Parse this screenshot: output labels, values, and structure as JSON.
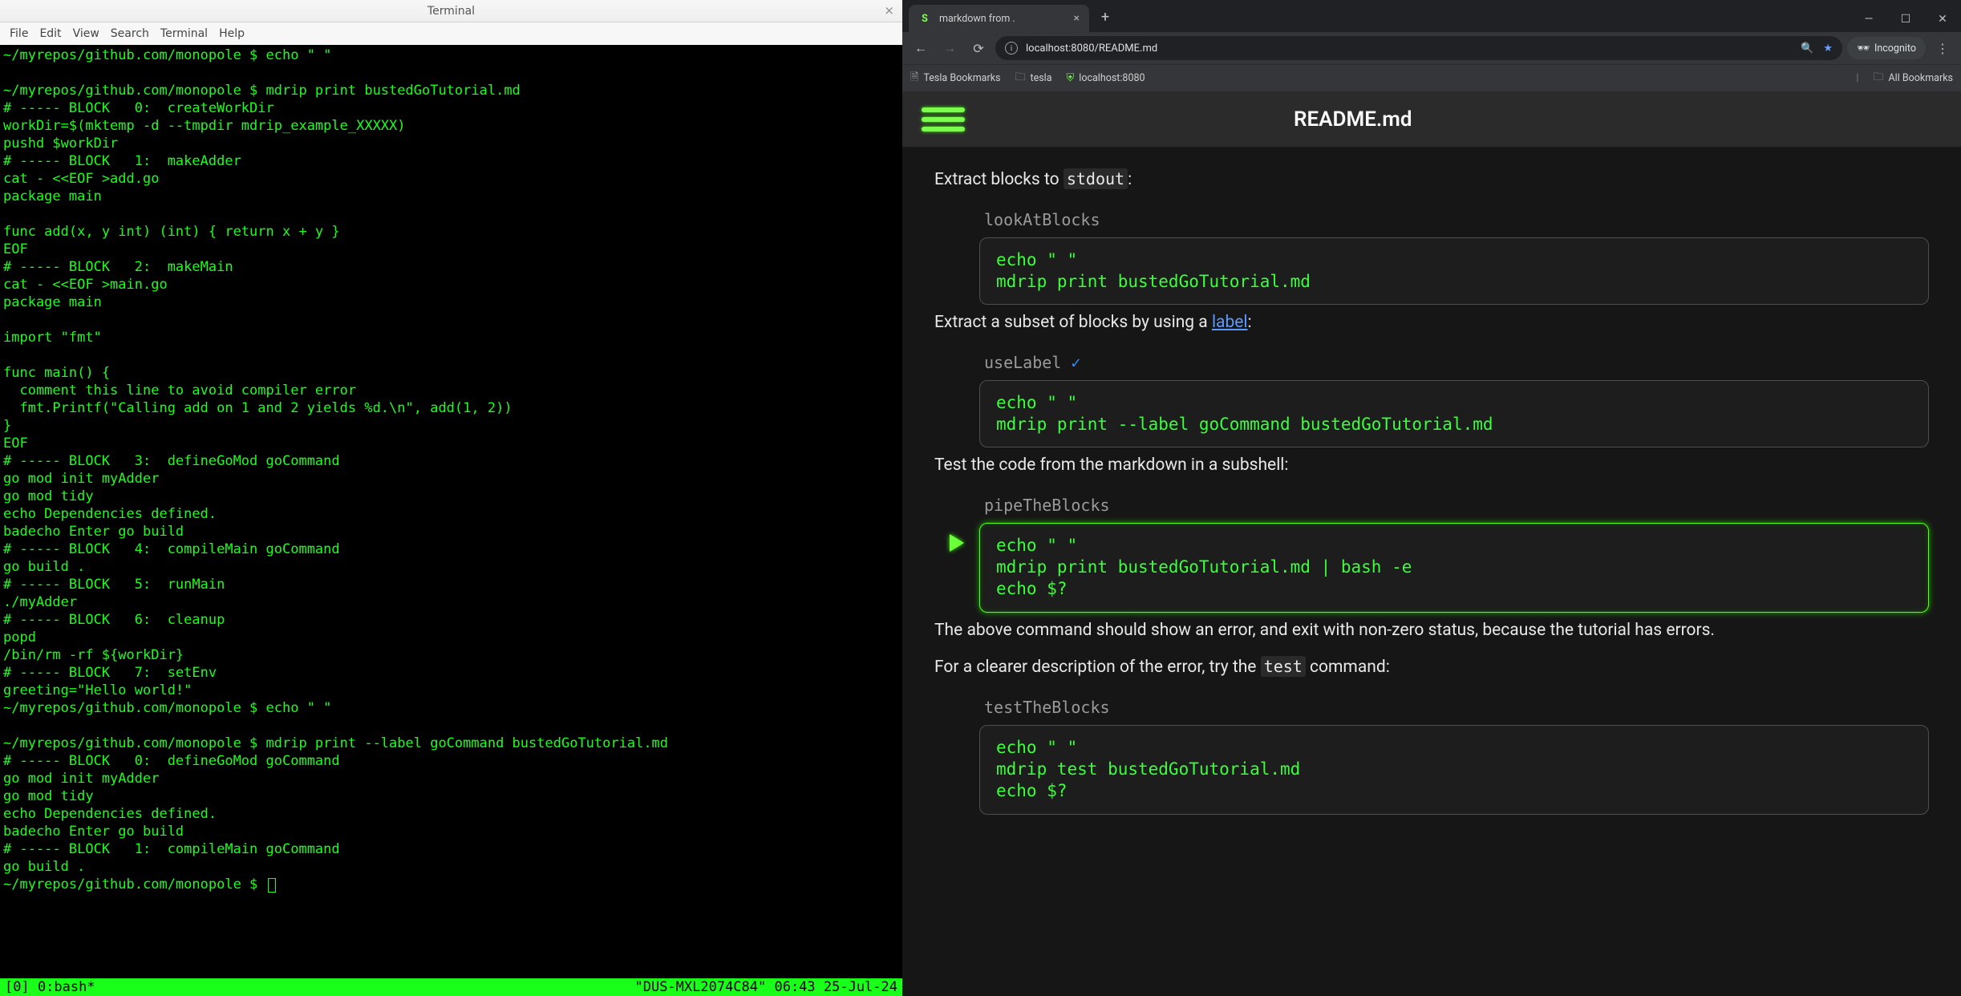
{
  "terminal": {
    "title": "Terminal",
    "menu": [
      "File",
      "Edit",
      "View",
      "Search",
      "Terminal",
      "Help"
    ],
    "lines": [
      "~/myrepos/github.com/monopole $ echo \" \"",
      "",
      "~/myrepos/github.com/monopole $ mdrip print bustedGoTutorial.md",
      "# ----- BLOCK   0:  createWorkDir",
      "workDir=$(mktemp -d --tmpdir mdrip_example_XXXXX)",
      "pushd $workDir",
      "# ----- BLOCK   1:  makeAdder",
      "cat - <<EOF >add.go",
      "package main",
      "",
      "func add(x, y int) (int) { return x + y }",
      "EOF",
      "# ----- BLOCK   2:  makeMain",
      "cat - <<EOF >main.go",
      "package main",
      "",
      "import \"fmt\"",
      "",
      "func main() {",
      "  comment this line to avoid compiler error",
      "  fmt.Printf(\"Calling add on 1 and 2 yields %d.\\n\", add(1, 2))",
      "}",
      "EOF",
      "# ----- BLOCK   3:  defineGoMod goCommand",
      "go mod init myAdder",
      "go mod tidy",
      "echo Dependencies defined.",
      "badecho Enter go build",
      "# ----- BLOCK   4:  compileMain goCommand",
      "go build .",
      "# ----- BLOCK   5:  runMain",
      "./myAdder",
      "# ----- BLOCK   6:  cleanup",
      "popd",
      "/bin/rm -rf ${workDir}",
      "# ----- BLOCK   7:  setEnv",
      "greeting=\"Hello world!\"",
      "~/myrepos/github.com/monopole $ echo \" \"",
      "",
      "~/myrepos/github.com/monopole $ mdrip print --label goCommand bustedGoTutorial.md",
      "# ----- BLOCK   0:  defineGoMod goCommand",
      "go mod init myAdder",
      "go mod tidy",
      "echo Dependencies defined.",
      "badecho Enter go build",
      "# ----- BLOCK   1:  compileMain goCommand",
      "go build .",
      "~/myrepos/github.com/monopole $ "
    ],
    "status_left": "[0] 0:bash*",
    "status_right": "\"DUS-MXL2074C84\" 06:43 25-Jul-24"
  },
  "browser": {
    "tab": {
      "title": "markdown from .",
      "favicon": "S"
    },
    "url": "localhost:8080/README.md",
    "incognito": "Incognito",
    "bookmarks": [
      {
        "icon": "doc",
        "label": "Tesla Bookmarks"
      },
      {
        "icon": "folder",
        "label": "tesla"
      },
      {
        "icon": "shield",
        "label": "localhost:8080"
      }
    ],
    "all_bookmarks": "All Bookmarks",
    "page": {
      "title": "README.md",
      "sections": [
        {
          "text_before": "Extract blocks to ",
          "code": "stdout",
          "text_after": ":",
          "label": "lookAtBlocks",
          "has_check": false,
          "has_run": false,
          "active": false,
          "code_content": "echo \" \"\nmdrip print bustedGoTutorial.md"
        },
        {
          "text_before": "Extract a subset of blocks by using a ",
          "link": "label",
          "text_after": ":",
          "label": "useLabel",
          "has_check": true,
          "has_run": false,
          "active": false,
          "code_content": "echo \" \"\nmdrip print --label goCommand bustedGoTutorial.md"
        },
        {
          "text_plain": "Test the code from the markdown in a subshell:",
          "label": "pipeTheBlocks",
          "has_check": false,
          "has_run": true,
          "active": true,
          "code_content": "echo \" \"\nmdrip print bustedGoTutorial.md | bash -e\necho $?"
        }
      ],
      "post_text": "The above command should show an error, and exit with non-zero status, because the tutorial has errors.",
      "post_text2_before": "For a clearer description of the error, try the ",
      "post_text2_code": "test",
      "post_text2_after": " command:",
      "last_label": "testTheBlocks",
      "last_code": "echo \" \"\nmdrip test bustedGoTutorial.md\necho $?"
    }
  }
}
